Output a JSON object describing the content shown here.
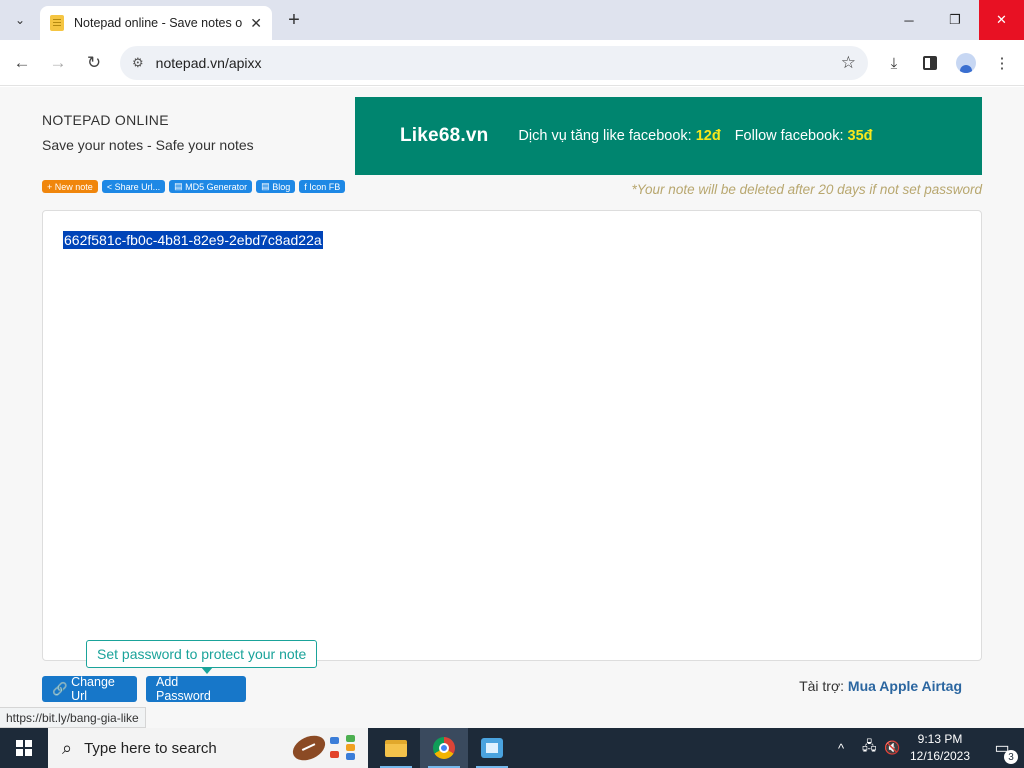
{
  "browser": {
    "tab_title": "Notepad online - Save notes o",
    "tab_close_icon": "close-icon",
    "new_tab_label": "+",
    "url": "notepad.vn/apixx",
    "window_minimize": "─",
    "window_maximize": "❐",
    "window_close": "✕"
  },
  "page": {
    "brand_title": "NOTEPAD ONLINE",
    "brand_subtitle": "Save your notes - Safe your notes",
    "banner": {
      "logo": "Like68.vn",
      "text1": "Dịch vụ tăng like facebook:",
      "price1": "12đ",
      "text2": "Follow facebook:",
      "price2": "35đ",
      "bg_color": "#00856f",
      "price_color": "#f8e71c"
    },
    "quick_links": [
      {
        "icon": "+",
        "label": "New note"
      },
      {
        "icon": "<",
        "label": "Share Url..."
      },
      {
        "icon": "▤",
        "label": "MD5 Generator"
      },
      {
        "icon": "▤",
        "label": "Blog"
      },
      {
        "icon": "f",
        "label": "Icon FB"
      }
    ],
    "notice": "*Your note will be deleted after 20 days if not set password",
    "note_content": "662f581c-fb0c-4b81-82e9-2ebd7c8ad22a",
    "tooltip": "Set password to protect your note",
    "change_url_label": "Change Url",
    "change_url_icon": "link-icon",
    "add_password_label": "Add Password",
    "sponsor_label": "Tài trợ:",
    "sponsor_link": "Mua Apple Airtag",
    "status_url": "https://bit.ly/bang-gia-like"
  },
  "taskbar": {
    "search_placeholder": "Type here to search",
    "clock_time": "9:13 PM",
    "clock_date": "12/16/2023",
    "notification_count": "3",
    "tray_chevron": "^",
    "tray_network": "🖧",
    "tray_volume": "🔇"
  }
}
